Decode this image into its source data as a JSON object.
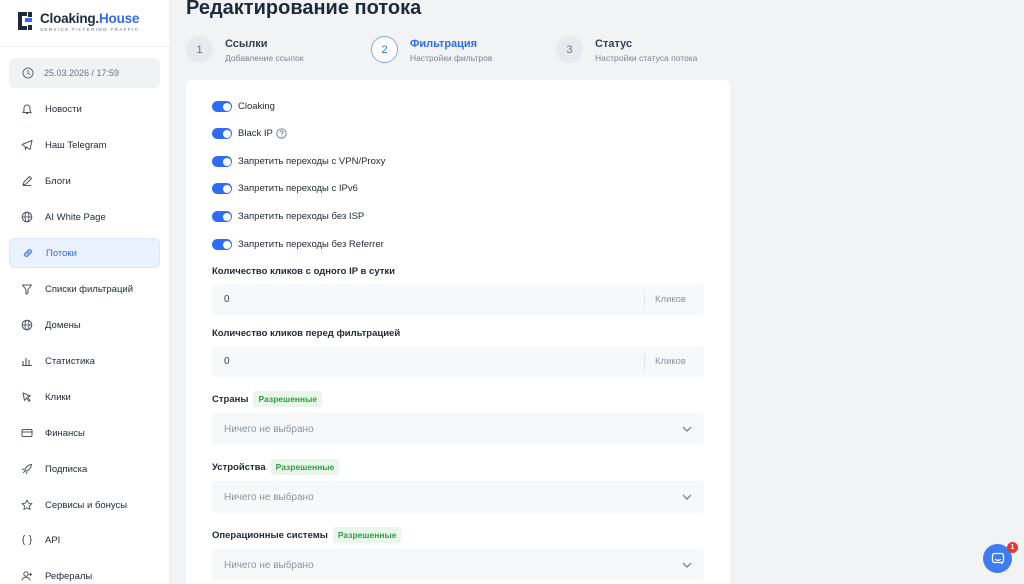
{
  "logo": {
    "name_part1": "Cloaking.",
    "name_part2": "House",
    "tagline": "SERVICE FILTERING TRAFFIC"
  },
  "sidebar": {
    "datetime": "25.03.2026 / 17:59",
    "items": [
      {
        "label": "Новости",
        "icon": "bell-icon"
      },
      {
        "label": "Наш Telegram",
        "icon": "telegram-icon"
      },
      {
        "label": "Блоги",
        "icon": "pencil-icon"
      },
      {
        "label": "AI White Page",
        "icon": "globe-icon"
      },
      {
        "label": "Потоки",
        "icon": "link-icon",
        "active": true
      },
      {
        "label": "Списки фильтраций",
        "icon": "filter-icon"
      },
      {
        "label": "Домены",
        "icon": "globe-icon"
      },
      {
        "label": "Статистика",
        "icon": "bar-chart-icon"
      },
      {
        "label": "Клики",
        "icon": "cursor-icon"
      },
      {
        "label": "Финансы",
        "icon": "card-icon"
      },
      {
        "label": "Подписка",
        "icon": "rocket-icon"
      },
      {
        "label": "Сервисы и бонусы",
        "icon": "star-icon"
      },
      {
        "label": "API",
        "icon": "braces-icon"
      },
      {
        "label": "Рефералы",
        "icon": "user-plus-icon"
      }
    ]
  },
  "page": {
    "title": "Редактирование потока"
  },
  "steps": [
    {
      "number": "1",
      "title": "Ссылки",
      "subtitle": "Добавление ссылок"
    },
    {
      "number": "2",
      "title": "Фильтрация",
      "subtitle": "Настройки фильтров",
      "active": true
    },
    {
      "number": "3",
      "title": "Статус",
      "subtitle": "Настройки статуса потока"
    }
  ],
  "toggles": [
    {
      "label": "Cloaking",
      "on": true
    },
    {
      "label": "Black IP",
      "on": true,
      "help": true
    },
    {
      "label": "Запретить переходы с VPN/Proxy",
      "on": true
    },
    {
      "label": "Запретить переходы с IPv6",
      "on": true
    },
    {
      "label": "Запретить переходы без ISP",
      "on": true
    },
    {
      "label": "Запретить переходы без Referrer",
      "on": true
    }
  ],
  "clicks_per_ip": {
    "label": "Количество кликов с одного IP в сутки",
    "value": "0",
    "suffix": "Кликов"
  },
  "clicks_before_filter": {
    "label": "Количество кликов перед фильтрацией",
    "value": "0",
    "suffix": "Кликов"
  },
  "countries": {
    "label": "Страны",
    "badge": "Разрешенные",
    "placeholder": "Ничего не выбрано"
  },
  "devices": {
    "label": "Устройства",
    "badge": "Разрешенные",
    "placeholder": "Ничего не выбрано"
  },
  "os": {
    "label": "Операционные системы",
    "badge": "Разрешенные",
    "placeholder": "Ничего не выбрано"
  },
  "chat": {
    "unread": "1"
  },
  "colors": {
    "accent": "#2f6cf6",
    "badge_green": "#2e9e45",
    "notification": "#e53935"
  }
}
